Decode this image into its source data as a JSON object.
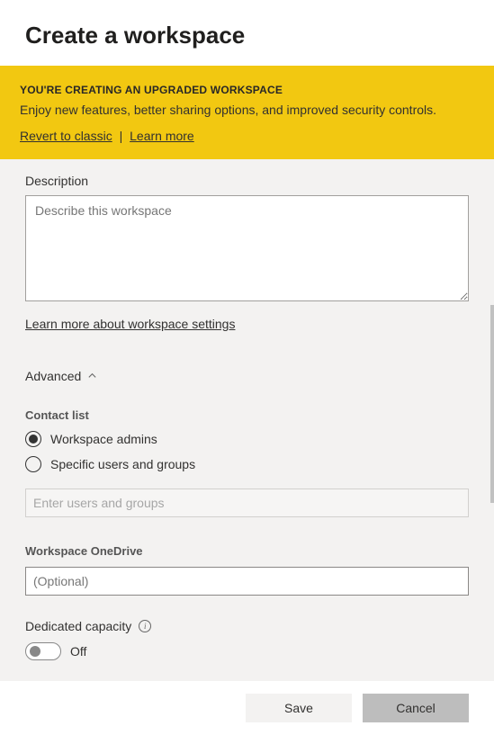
{
  "header": {
    "title": "Create a workspace"
  },
  "banner": {
    "heading": "YOU'RE CREATING AN UPGRADED WORKSPACE",
    "text": "Enjoy new features, better sharing options, and improved security controls.",
    "revert_link": "Revert to classic",
    "learn_more_link": "Learn more"
  },
  "description": {
    "label": "Description",
    "placeholder": "Describe this workspace",
    "value": ""
  },
  "settings_link": "Learn more about workspace settings",
  "advanced": {
    "label": "Advanced",
    "expanded": true
  },
  "contact_list": {
    "label": "Contact list",
    "options": {
      "admins": "Workspace admins",
      "specific": "Specific users and groups"
    },
    "selected": "admins",
    "users_placeholder": "Enter users and groups"
  },
  "onedrive": {
    "label": "Workspace OneDrive",
    "placeholder": "(Optional)",
    "value": ""
  },
  "capacity": {
    "label": "Dedicated capacity",
    "toggle_state": "Off"
  },
  "footer": {
    "save": "Save",
    "cancel": "Cancel"
  }
}
